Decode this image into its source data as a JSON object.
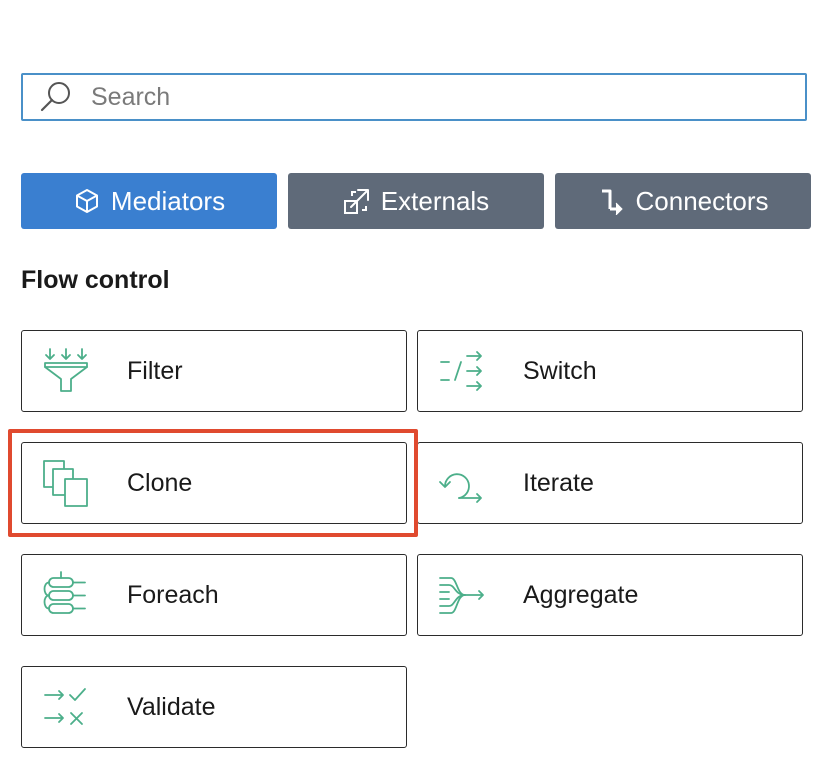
{
  "search": {
    "placeholder": "Search",
    "value": ""
  },
  "tabs": [
    {
      "label": "Mediators",
      "icon": "cube-icon",
      "active": true
    },
    {
      "label": "Externals",
      "icon": "external-link-icon",
      "active": false
    },
    {
      "label": "Connectors",
      "icon": "connector-icon",
      "active": false
    }
  ],
  "section": {
    "title": "Flow control"
  },
  "mediators": [
    {
      "label": "Filter",
      "icon": "filter-icon"
    },
    {
      "label": "Switch",
      "icon": "switch-icon"
    },
    {
      "label": "Clone",
      "icon": "clone-icon",
      "highlighted": true
    },
    {
      "label": "Iterate",
      "icon": "iterate-icon"
    },
    {
      "label": "Foreach",
      "icon": "foreach-icon"
    },
    {
      "label": "Aggregate",
      "icon": "aggregate-icon"
    },
    {
      "label": "Validate",
      "icon": "validate-icon"
    }
  ],
  "colors": {
    "accent": "#3a7fd0",
    "tab_inactive": "#5f6a79",
    "icon_green": "#4caf8a",
    "highlight": "#e04a2f",
    "search_border": "#4a90c8"
  }
}
